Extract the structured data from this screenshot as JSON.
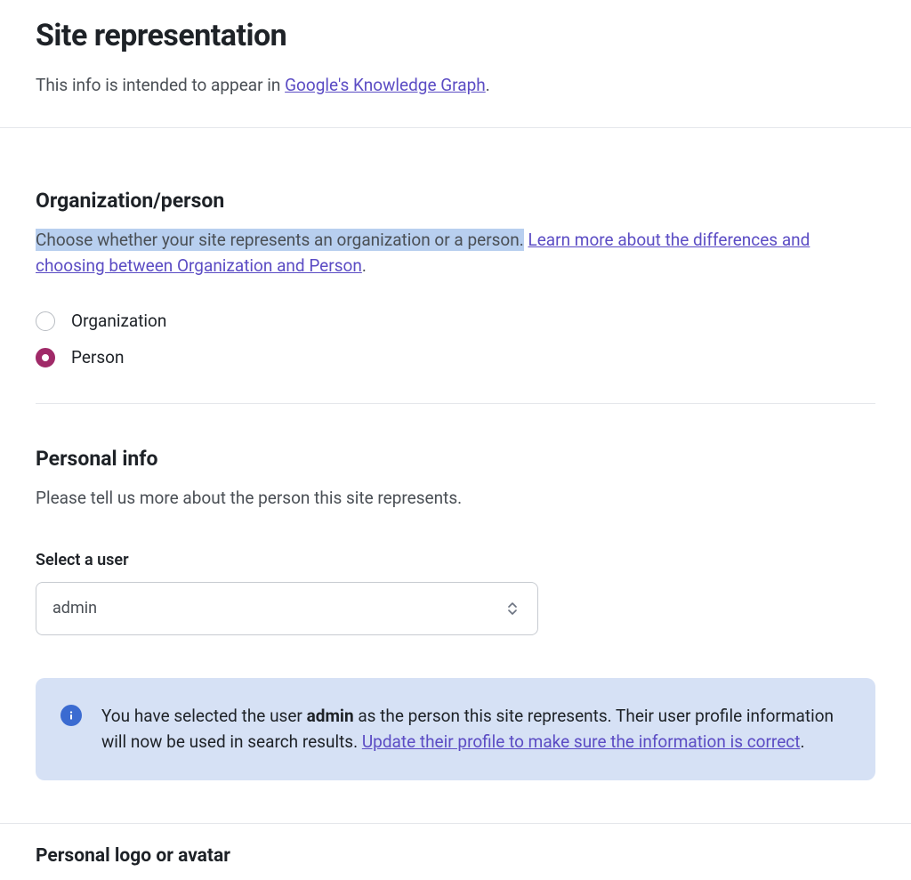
{
  "page": {
    "title": "Site representation",
    "description_prefix": "This info is intended to appear in ",
    "description_link": "Google's Knowledge Graph",
    "description_suffix": "."
  },
  "org_person": {
    "title": "Organization/person",
    "desc_highlighted": "Choose whether your site represents an organization or a person.",
    "desc_link": "Learn more about the differences and choosing between Organization and Person",
    "desc_suffix": ".",
    "options": {
      "organization": "Organization",
      "person": "Person"
    },
    "selected": "person"
  },
  "personal_info": {
    "title": "Personal info",
    "description": "Please tell us more about the person this site represents.",
    "select_label": "Select a user",
    "select_value": "admin"
  },
  "info_box": {
    "text_before_strong": "You have selected the user ",
    "strong_text": "admin",
    "text_after_strong": " as the person this site represents. Their user profile information will now be used in search results. ",
    "link_text": "Update their profile to make sure the information is correct",
    "suffix": "."
  },
  "logo_section": {
    "title": "Personal logo or avatar"
  }
}
